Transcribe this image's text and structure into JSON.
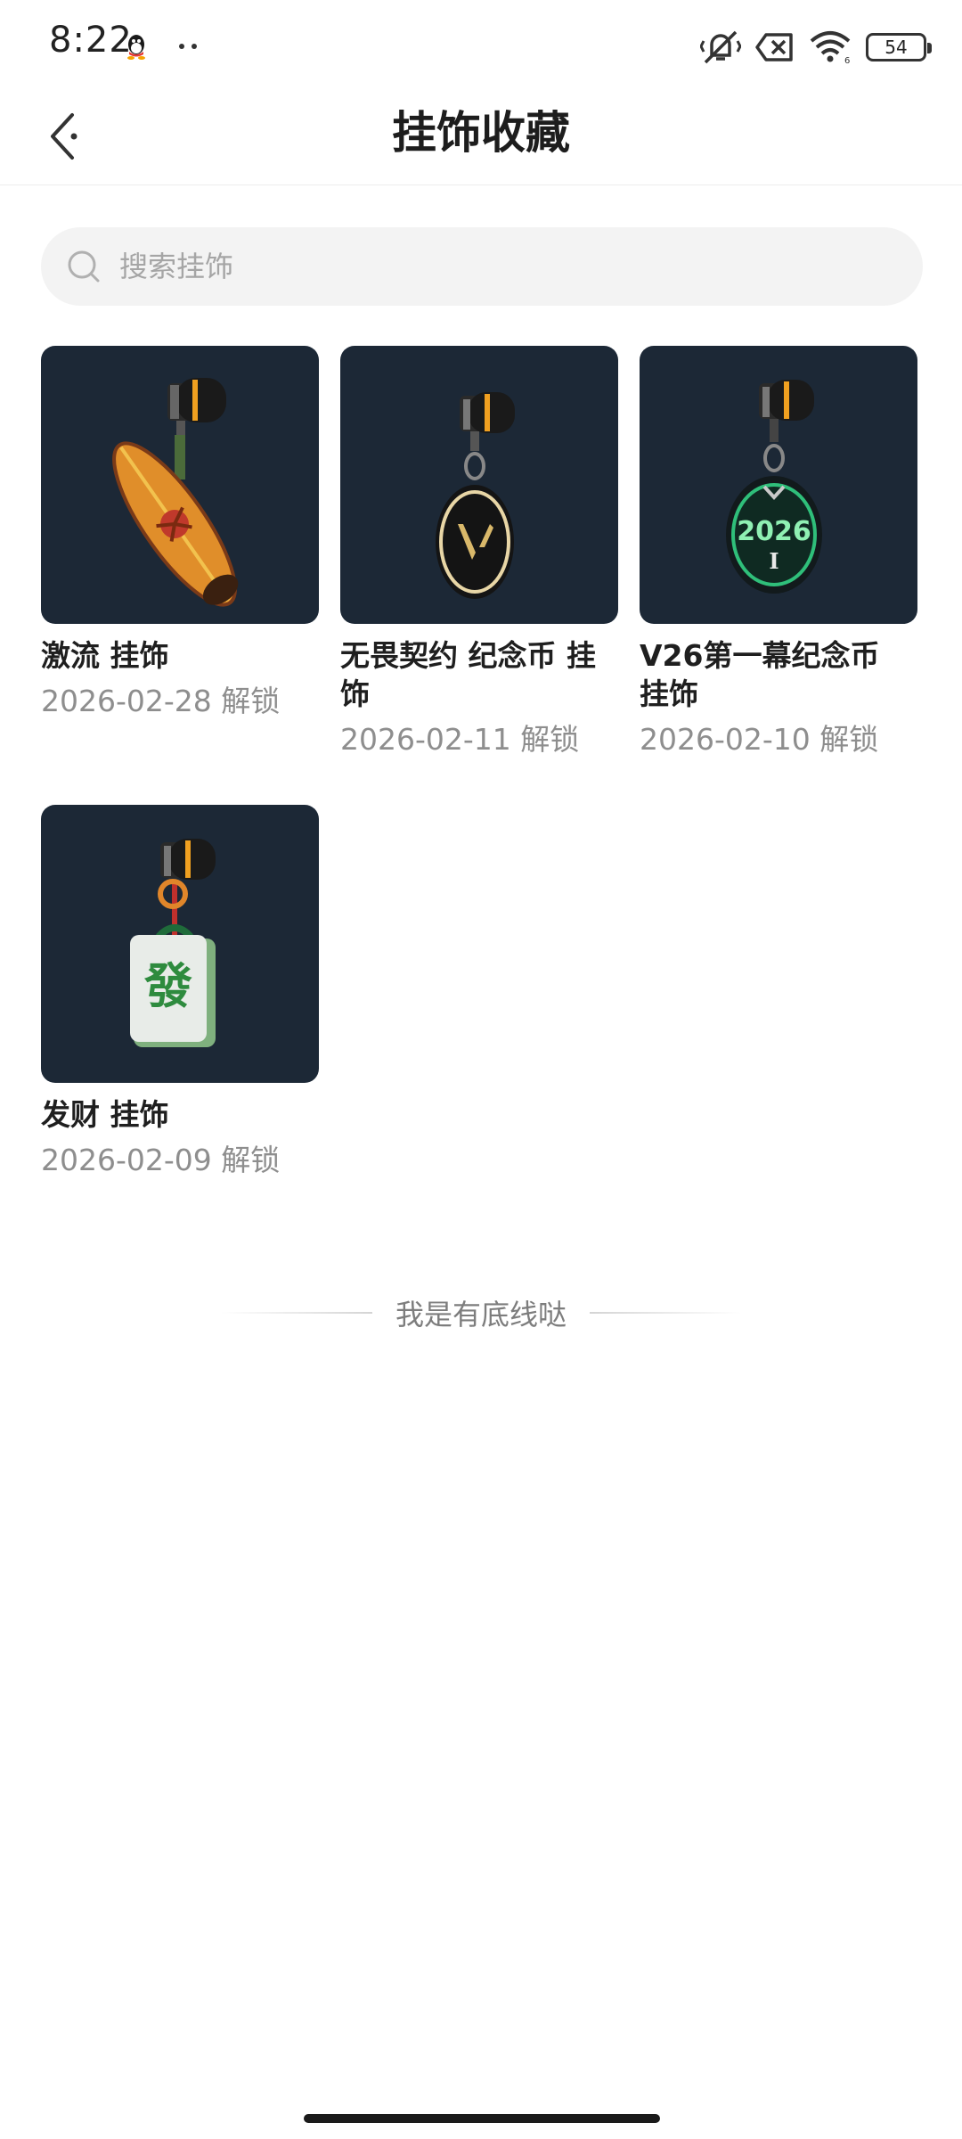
{
  "status_bar": {
    "time": "8:22",
    "battery": "54",
    "icons": [
      "qq-icon",
      "more-dots-icon",
      "mute-vibrate-icon",
      "no-sim-icon",
      "wifi-icon",
      "battery-icon"
    ]
  },
  "header": {
    "title": "挂饰收藏",
    "back_icon": "chevron-left-icon"
  },
  "search": {
    "placeholder": "搜索挂饰",
    "value": ""
  },
  "items": [
    {
      "name": "激流 挂饰",
      "date": "2026-02-28 解锁",
      "icon": "surfboard-charm"
    },
    {
      "name": "无畏契约 纪念币 挂饰",
      "date": "2026-02-11 解锁",
      "icon": "valorant-coin-charm"
    },
    {
      "name": "V26第一幕纪念币 挂饰",
      "date": "2026-02-10 解锁",
      "icon": "v26-coin-charm",
      "badge_year": "2026",
      "badge_act": "I"
    },
    {
      "name": "发财 挂饰",
      "date": "2026-02-09 解锁",
      "icon": "mahjong-tile-charm",
      "tile_char": "發"
    }
  ],
  "footer": {
    "end_text": "我是有底线哒"
  },
  "colors": {
    "thumb_bg": "#1c2836",
    "accent_orange": "#f0a020",
    "text_primary": "#1f1f1f",
    "text_secondary": "#8e8e8e"
  }
}
